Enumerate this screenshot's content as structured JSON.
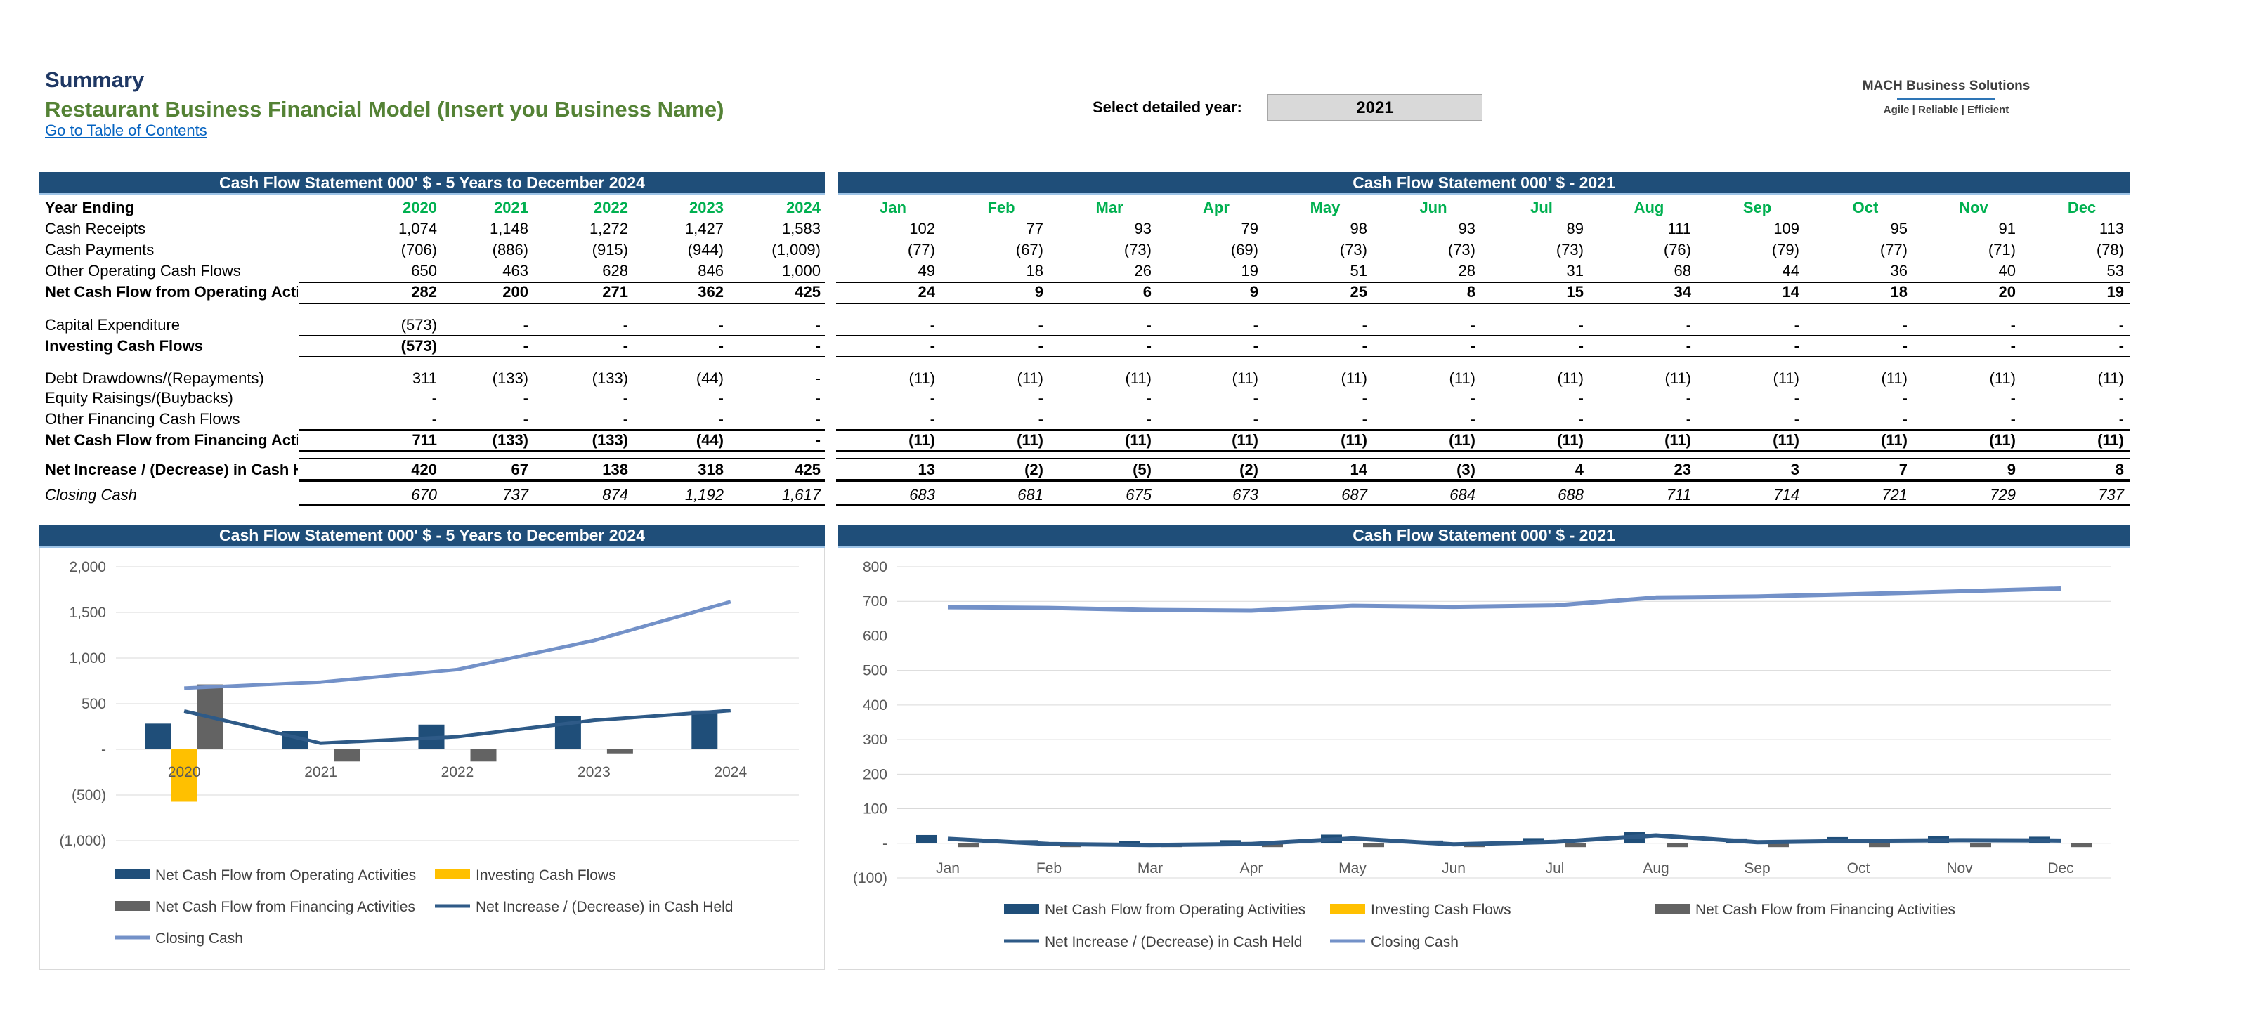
{
  "header": {
    "title": "Summary",
    "subtitle": "Restaurant Business Financial Model (Insert you Business Name)",
    "toc_link": "Go to Table of Contents",
    "select_year_label": "Select detailed year:",
    "selected_year": "2021",
    "logo_name": "MACH Business Solutions",
    "logo_tagline": "Agile | Reliable | Efficient"
  },
  "colors": {
    "banner": "#1f4e79",
    "header_green": "#00b050",
    "title_blue": "#1f3864",
    "subtitle_green": "#548235",
    "operating": "#1f4e79",
    "investing": "#ffc000",
    "financing": "#636363",
    "net_increase": "#2e5a87",
    "closing_cash": "#7391c8"
  },
  "annual_table": {
    "banner": "Cash Flow Statement 000' $ - 5 Years to December 2024",
    "header_label": "Year Ending",
    "columns": [
      "2020",
      "2021",
      "2022",
      "2023",
      "2024"
    ],
    "rows": [
      {
        "label": "Cash Receipts",
        "values": [
          "1,074",
          "1,148",
          "1,272",
          "1,427",
          "1,583"
        ]
      },
      {
        "label": "Cash Payments",
        "values": [
          "(706)",
          "(886)",
          "(915)",
          "(944)",
          "(1,009)"
        ]
      },
      {
        "label": "Other Operating Cash Flows",
        "values": [
          "650",
          "463",
          "628",
          "846",
          "1,000"
        ]
      },
      {
        "label": "Net Cash Flow from Operating Activities",
        "values": [
          "282",
          "200",
          "271",
          "362",
          "425"
        ]
      },
      {
        "label": "Capital Expenditure",
        "values": [
          "(573)",
          "-",
          "-",
          "-",
          "-"
        ]
      },
      {
        "label": "Investing Cash Flows",
        "values": [
          "(573)",
          "-",
          "-",
          "-",
          "-"
        ]
      },
      {
        "label": "Debt Drawdowns/(Repayments)",
        "values": [
          "311",
          "(133)",
          "(133)",
          "(44)",
          "-"
        ]
      },
      {
        "label": "Equity Raisings/(Buybacks)",
        "values": [
          "-",
          "-",
          "-",
          "-",
          "-"
        ]
      },
      {
        "label": "Other Financing Cash Flows",
        "values": [
          "-",
          "-",
          "-",
          "-",
          "-"
        ]
      },
      {
        "label": "Net Cash Flow from Financing Activities",
        "values": [
          "711",
          "(133)",
          "(133)",
          "(44)",
          "-"
        ]
      },
      {
        "label": "Net Increase / (Decrease) in Cash Held",
        "values": [
          "420",
          "67",
          "138",
          "318",
          "425"
        ]
      },
      {
        "label": "Closing Cash",
        "values": [
          "670",
          "737",
          "874",
          "1,192",
          "1,617"
        ]
      }
    ]
  },
  "monthly_table": {
    "banner": "Cash Flow Statement 000' $ - 2021",
    "columns": [
      "Jan",
      "Feb",
      "Mar",
      "Apr",
      "May",
      "Jun",
      "Jul",
      "Aug",
      "Sep",
      "Oct",
      "Nov",
      "Dec"
    ],
    "rows": [
      {
        "values": [
          "102",
          "77",
          "93",
          "79",
          "98",
          "93",
          "89",
          "111",
          "109",
          "95",
          "91",
          "113"
        ]
      },
      {
        "values": [
          "(77)",
          "(67)",
          "(73)",
          "(69)",
          "(73)",
          "(73)",
          "(73)",
          "(76)",
          "(79)",
          "(77)",
          "(71)",
          "(78)"
        ]
      },
      {
        "values": [
          "49",
          "18",
          "26",
          "19",
          "51",
          "28",
          "31",
          "68",
          "44",
          "36",
          "40",
          "53"
        ]
      },
      {
        "values": [
          "24",
          "9",
          "6",
          "9",
          "25",
          "8",
          "15",
          "34",
          "14",
          "18",
          "20",
          "19"
        ]
      },
      {
        "values": [
          "-",
          "-",
          "-",
          "-",
          "-",
          "-",
          "-",
          "-",
          "-",
          "-",
          "-",
          "-"
        ]
      },
      {
        "values": [
          "-",
          "-",
          "-",
          "-",
          "-",
          "-",
          "-",
          "-",
          "-",
          "-",
          "-",
          "-"
        ]
      },
      {
        "values": [
          "(11)",
          "(11)",
          "(11)",
          "(11)",
          "(11)",
          "(11)",
          "(11)",
          "(11)",
          "(11)",
          "(11)",
          "(11)",
          "(11)"
        ]
      },
      {
        "values": [
          "-",
          "-",
          "-",
          "-",
          "-",
          "-",
          "-",
          "-",
          "-",
          "-",
          "-",
          "-"
        ]
      },
      {
        "values": [
          "-",
          "-",
          "-",
          "-",
          "-",
          "-",
          "-",
          "-",
          "-",
          "-",
          "-",
          "-"
        ]
      },
      {
        "values": [
          "(11)",
          "(11)",
          "(11)",
          "(11)",
          "(11)",
          "(11)",
          "(11)",
          "(11)",
          "(11)",
          "(11)",
          "(11)",
          "(11)"
        ]
      },
      {
        "values": [
          "13",
          "(2)",
          "(5)",
          "(2)",
          "14",
          "(3)",
          "4",
          "23",
          "3",
          "7",
          "9",
          "8"
        ]
      },
      {
        "values": [
          "683",
          "681",
          "675",
          "673",
          "687",
          "684",
          "688",
          "711",
          "714",
          "721",
          "729",
          "737"
        ]
      }
    ]
  },
  "chart_data": [
    {
      "type": "bar",
      "banner": "Cash Flow Statement 000' $ - 5 Years to December 2024",
      "categories": [
        "2020",
        "2021",
        "2022",
        "2023",
        "2024"
      ],
      "ylim": [
        -1000,
        2000
      ],
      "yticks": [
        -1000,
        -500,
        0,
        500,
        1000,
        1500,
        2000
      ],
      "ytick_labels": [
        "(1,000)",
        "(500)",
        "-",
        "500",
        "1,000",
        "1,500",
        "2,000"
      ],
      "grid": true,
      "legend_placement": "bottom",
      "series": [
        {
          "name": "Net Cash Flow from Operating Activities",
          "kind": "bar",
          "values": [
            282,
            200,
            271,
            362,
            425
          ]
        },
        {
          "name": "Investing Cash Flows",
          "kind": "bar",
          "values": [
            -573,
            0,
            0,
            0,
            0
          ]
        },
        {
          "name": "Net Cash Flow from Financing Activities",
          "kind": "bar",
          "values": [
            711,
            -133,
            -133,
            -44,
            0
          ]
        },
        {
          "name": "Net Increase / (Decrease) in Cash Held",
          "kind": "line",
          "values": [
            420,
            67,
            138,
            318,
            425
          ]
        },
        {
          "name": "Closing Cash",
          "kind": "line",
          "values": [
            670,
            737,
            874,
            1192,
            1617
          ]
        }
      ]
    },
    {
      "type": "bar",
      "banner": "Cash Flow Statement 000' $ - 2021",
      "categories": [
        "Jan",
        "Feb",
        "Mar",
        "Apr",
        "May",
        "Jun",
        "Jul",
        "Aug",
        "Sep",
        "Oct",
        "Nov",
        "Dec"
      ],
      "ylim": [
        -100,
        800
      ],
      "yticks": [
        -100,
        0,
        100,
        200,
        300,
        400,
        500,
        600,
        700,
        800
      ],
      "ytick_labels": [
        "(100)",
        "-",
        "100",
        "200",
        "300",
        "400",
        "500",
        "600",
        "700",
        "800"
      ],
      "grid": true,
      "legend_placement": "bottom",
      "series": [
        {
          "name": "Net Cash Flow from Operating Activities",
          "kind": "bar",
          "values": [
            24,
            9,
            6,
            9,
            25,
            8,
            15,
            34,
            14,
            18,
            20,
            19
          ]
        },
        {
          "name": "Investing Cash Flows",
          "kind": "bar",
          "values": [
            0,
            0,
            0,
            0,
            0,
            0,
            0,
            0,
            0,
            0,
            0,
            0
          ]
        },
        {
          "name": "Net Cash Flow from Financing Activities",
          "kind": "bar",
          "values": [
            -11,
            -11,
            -11,
            -11,
            -11,
            -11,
            -11,
            -11,
            -11,
            -11,
            -11,
            -11
          ]
        },
        {
          "name": "Net Increase / (Decrease) in Cash Held",
          "kind": "line",
          "values": [
            13,
            -2,
            -5,
            -2,
            14,
            -3,
            4,
            23,
            3,
            7,
            9,
            8
          ]
        },
        {
          "name": "Closing Cash",
          "kind": "line",
          "values": [
            683,
            681,
            675,
            673,
            687,
            684,
            688,
            711,
            714,
            721,
            729,
            737
          ]
        }
      ]
    }
  ]
}
